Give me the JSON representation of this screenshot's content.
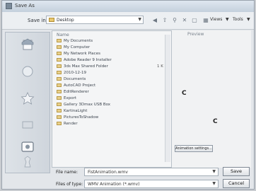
{
  "window": {
    "title": "Save As"
  },
  "toolbar": {
    "save_in_label": "Save in:",
    "location": "Desktop",
    "views_label": "Views",
    "tools_label": "Tools"
  },
  "preview": {
    "label": "Preview"
  },
  "file_list": {
    "column_name": "Name",
    "items": [
      {
        "name": "My Documents",
        "size": ""
      },
      {
        "name": "My Computer",
        "size": ""
      },
      {
        "name": "My Network Places",
        "size": ""
      },
      {
        "name": "Adobe Reader 9 Installer",
        "size": ""
      },
      {
        "name": "3ds Max Shared Folder",
        "size": "1 K"
      },
      {
        "name": "2010-12-19",
        "size": ""
      },
      {
        "name": "Documents",
        "size": ""
      },
      {
        "name": "AutoCAD Project",
        "size": ""
      },
      {
        "name": "EditRenderer",
        "size": ""
      },
      {
        "name": "Export",
        "size": ""
      },
      {
        "name": "Gallery 3Dmax USB Box",
        "size": ""
      },
      {
        "name": "KartinaLight",
        "size": ""
      },
      {
        "name": "PicturesToShadow",
        "size": ""
      },
      {
        "name": "Render",
        "size": ""
      }
    ]
  },
  "animation_settings_label": "Animation settings...",
  "file_name": {
    "label": "File name:",
    "value": "FistAnimation.wmv"
  },
  "file_type": {
    "label": "Files of type:",
    "value": "WMV Animation (*.wmv)"
  },
  "buttons": {
    "save": "Save",
    "cancel": "Cancel"
  },
  "preview_letters": [
    "C",
    "C"
  ]
}
